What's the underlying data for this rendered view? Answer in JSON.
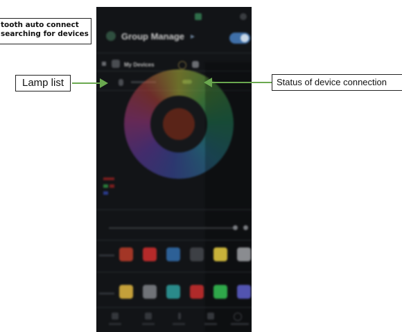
{
  "annotations": {
    "bluetooth_line1": "tooth auto connect",
    "bluetooth_line2": "searching for devices",
    "lamp_list": "Lamp list",
    "device_status": "Status of device connection"
  },
  "app": {
    "title": "Group Manage",
    "group_row_label": "My Devices"
  },
  "colors": {
    "annotation_line": "#6aa84f",
    "phone_background": "#121417",
    "toggle_on": "#3f6fa8",
    "swatches_row1": [
      "#a33626",
      "#b52a2a",
      "#2d6096",
      "#3d4045",
      "#c8b23a",
      "#8a8c90"
    ],
    "swatches_row2": [
      "#c4a03a",
      "#707378",
      "#2a8a8a",
      "#b02a2a",
      "#2fa84a",
      "#5254b0"
    ]
  },
  "icons": [
    "bluetooth-icon",
    "group-icon",
    "chevron-icon",
    "edit-icon",
    "lamp-icon",
    "link-icon",
    "gear-icon",
    "bulb-icon"
  ]
}
